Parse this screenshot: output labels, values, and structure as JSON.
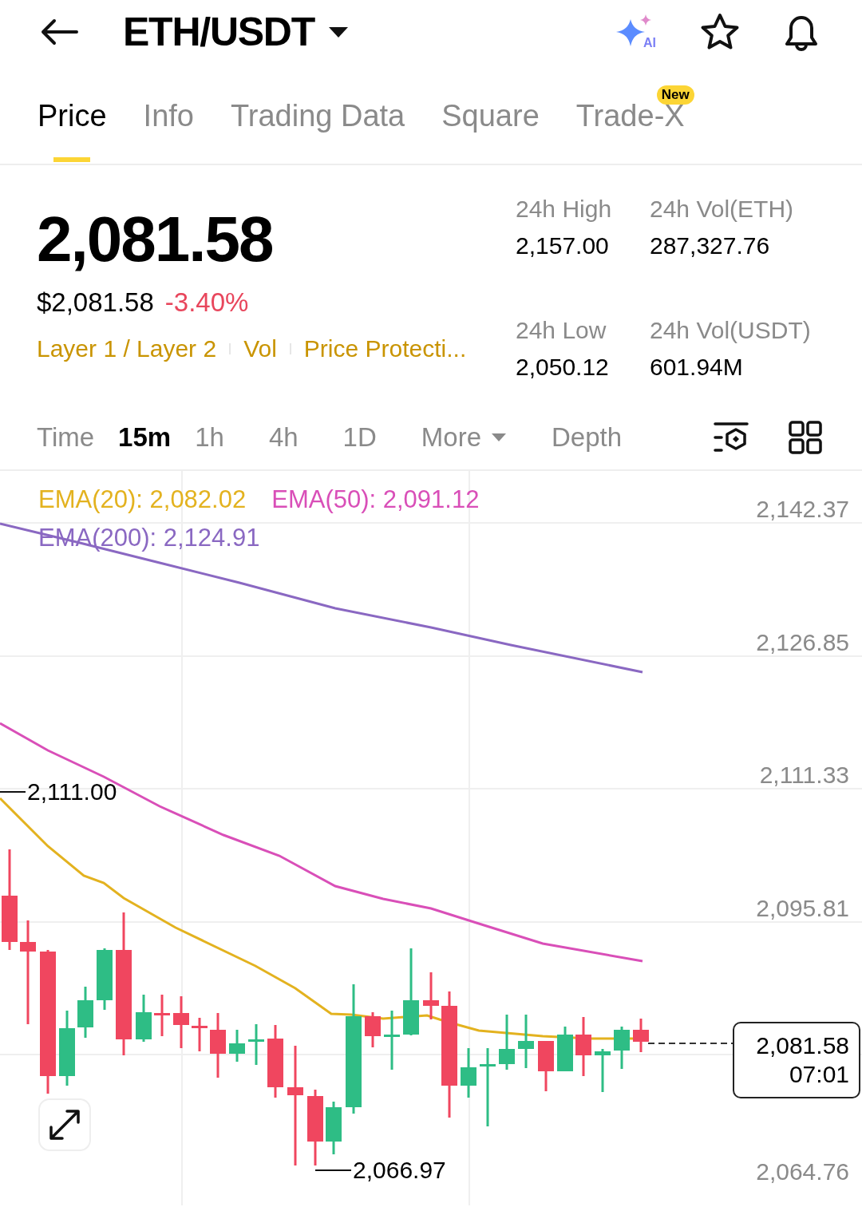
{
  "header": {
    "pair": "ETH/USDT",
    "ai_label": "AI"
  },
  "tabs": [
    {
      "label": "Price",
      "selected": true
    },
    {
      "label": "Info",
      "selected": false
    },
    {
      "label": "Trading Data",
      "selected": false
    },
    {
      "label": "Square",
      "selected": false
    },
    {
      "label": "Trade-X",
      "selected": false,
      "badge": "New"
    }
  ],
  "price": {
    "last": "2,081.58",
    "usd": "$2,081.58",
    "change": "-3.40%"
  },
  "tags": [
    "Layer 1 / Layer 2",
    "Vol",
    "Price Protecti..."
  ],
  "stats": [
    {
      "label": "24h High",
      "value": "2,157.00"
    },
    {
      "label": "24h Vol(ETH)",
      "value": "287,327.76"
    },
    {
      "label": "24h Low",
      "value": "2,050.12"
    },
    {
      "label": "24h Vol(USDT)",
      "value": "601.94M"
    }
  ],
  "intervals": [
    {
      "label": "Time",
      "kind": "option",
      "selected": false
    },
    {
      "label": "15m",
      "kind": "option",
      "selected": true
    },
    {
      "label": "1h",
      "kind": "option",
      "selected": false
    },
    {
      "label": "4h",
      "kind": "option",
      "selected": false
    },
    {
      "label": "1D",
      "kind": "option",
      "selected": false
    },
    {
      "label": "More",
      "kind": "dropdown",
      "selected": false
    },
    {
      "label": "Depth",
      "kind": "option",
      "selected": false
    }
  ],
  "chart": {
    "indicators": [
      {
        "label": "EMA(20): 2,082.02",
        "color": "#e3b21f"
      },
      {
        "label": "EMA(50): 2,091.12",
        "color": "#d94fb8"
      },
      {
        "label": "EMA(200): 2,124.91",
        "color": "#8a68c2"
      }
    ],
    "price_ticks": [
      "2,142.37",
      "2,126.85",
      "2,111.33",
      "2,095.81",
      "2,064.76"
    ],
    "high_marker": "2,111.00",
    "low_marker": "2,066.97",
    "last_price": "2,081.58",
    "countdown": "07:01"
  }
}
